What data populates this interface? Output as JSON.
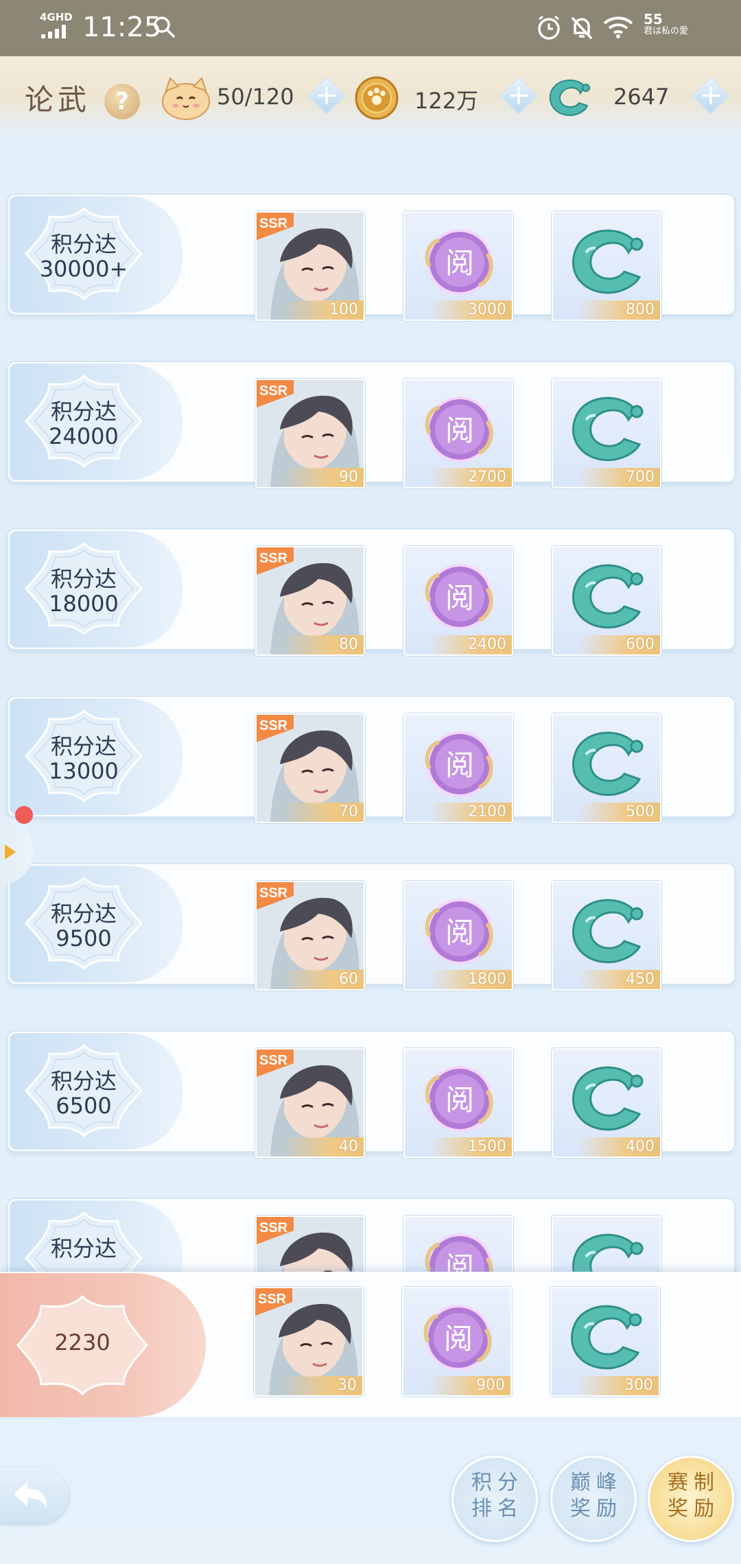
{
  "status_bar": {
    "network": "4GHD",
    "time": "11:25",
    "battery": "55",
    "carrier_text": "君は私の愛"
  },
  "header": {
    "title": "论武",
    "help_label": "?",
    "stamina": "50/120",
    "coins": "122万",
    "jade": "2647"
  },
  "rewards": [
    {
      "label": "积分达",
      "threshold": "30000+",
      "items": [
        "100",
        "3000",
        "800"
      ]
    },
    {
      "label": "积分达",
      "threshold": "24000",
      "items": [
        "90",
        "2700",
        "700"
      ]
    },
    {
      "label": "积分达",
      "threshold": "18000",
      "items": [
        "80",
        "2400",
        "600"
      ]
    },
    {
      "label": "积分达",
      "threshold": "13000",
      "items": [
        "70",
        "2100",
        "500"
      ]
    },
    {
      "label": "积分达",
      "threshold": "9500",
      "items": [
        "60",
        "1800",
        "450"
      ]
    },
    {
      "label": "积分达",
      "threshold": "6500",
      "items": [
        "40",
        "1500",
        "400"
      ]
    },
    {
      "label": "积分达",
      "threshold": "",
      "items": [
        "",
        "",
        ""
      ]
    }
  ],
  "current": {
    "score": "2230",
    "items": [
      "30",
      "900",
      "300"
    ]
  },
  "nav": {
    "points_rank": "积分排名",
    "peak_reward": "巅峰奖励",
    "season_reward": "赛制奖励"
  },
  "badge_text": {
    "ssr": "SSR",
    "yue": "阅"
  },
  "colors": {
    "accent_blue": "#cde2f5",
    "current_pink": "#f1b8aa",
    "count_gold": "#ecc27a",
    "active_gold": "#f3d27a"
  }
}
